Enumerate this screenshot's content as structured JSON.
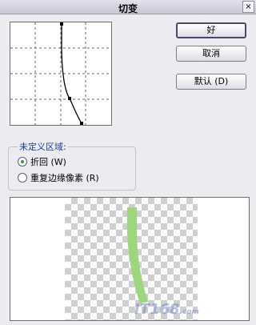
{
  "window": {
    "title": "切变",
    "close_glyph": "×"
  },
  "buttons": {
    "ok": "好",
    "cancel": "取消",
    "default": "默认 (D)"
  },
  "undefined_area": {
    "legend": "未定义区域:",
    "options": [
      {
        "label": "折回 (W)",
        "selected": true
      },
      {
        "label": "重复边缘像素 (R)",
        "selected": false
      }
    ]
  },
  "preview": {
    "stroke_color": "#9ed67d"
  },
  "watermark": {
    "brand": "IT168",
    "suffix": ".com"
  }
}
